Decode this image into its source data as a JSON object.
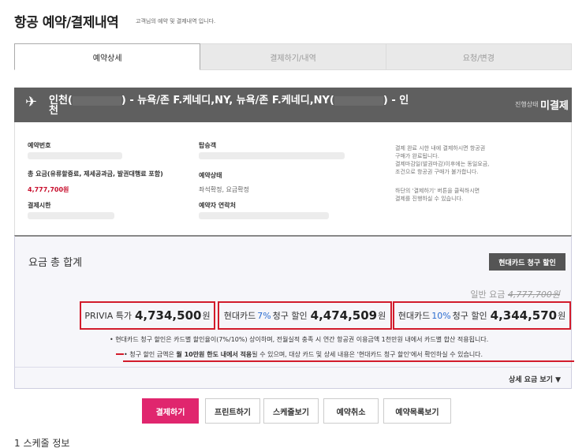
{
  "header": {
    "title": "항공 예약/결제내역",
    "subtitle": "고객님의 예약 및 결제내역 입니다."
  },
  "tabs": [
    {
      "label": "예약상세",
      "active": true
    },
    {
      "label": "결제하기/내역",
      "active": false
    },
    {
      "label": "요청/변경",
      "active": false
    }
  ],
  "flight": {
    "route_a": "인천(",
    "route_b": ") - 뉴욕/존 F.케네디,NY, 뉴욕/존 F.케네디,NY(",
    "route_c": ") - 인",
    "route_d": "천",
    "status_label": "진행상태",
    "status_value": "미결제"
  },
  "info": {
    "booking_no_label": "예약번호",
    "passenger_label": "탑승객",
    "total_label": "총 요금(유류할증료, 제세공과금, 발권대행료 포함)",
    "total_value": "4,777,700원",
    "booking_status_label": "예약상태",
    "booking_status_value": "좌석확정, 요금확정",
    "deadline_label": "결제시한",
    "contact_label": "예약자 연락처",
    "notice_lines": [
      "결제 완료 시한 내에 결제하시면 항공권",
      "구매가 완료됩니다.",
      "결제마감일(발권마감)이후에는 동일요금,",
      "조건으로 항공권 구매가 불가합니다."
    ],
    "notice2_lines": [
      "하단의 '결제하기' 버튼을 클릭하시면",
      "결제를 진행하실 수 있습니다."
    ]
  },
  "summary": {
    "title": "요금 총 합계",
    "hyundai_button": "현대카드 청구 할인",
    "normal_fare_label": "일반 요금",
    "normal_fare_value": "4,777,700원",
    "prices": [
      {
        "prefix": "PRIVIA 특가",
        "rate": "",
        "suffix": "",
        "amount": "4,734,500",
        "unit": "원"
      },
      {
        "prefix": "현대카드",
        "rate": "7%",
        "suffix": "청구 할인",
        "amount": "4,474,509",
        "unit": "원"
      },
      {
        "prefix": "현대카드",
        "rate": "10%",
        "suffix": "청구 할인",
        "amount": "4,344,570",
        "unit": "원"
      }
    ],
    "note1": "• 현대카드 청구 할인은 카드별 할인율이(7%/10%) 상이하며, 전월실적 충족 시 연간 항공권 이용금액 1천만원 내에서 카드별 합산 적용됩니다.",
    "note2_a": "• 청구 할인 금액은 ",
    "note2_b": "월 10만원 한도 내에서 적용",
    "note2_c": "될 수 있으며, 대상 카드 및 상세 내용은 '현대카드 청구 할인'에서 확인하실 수 있습니다.",
    "detail_link": "상세 요금 보기 ▼"
  },
  "actions": {
    "pay": "결제하기",
    "print": "프린트하기",
    "schedule": "스케줄보기",
    "cancel": "예약취소",
    "list": "예약목록보기"
  },
  "schedule_title": "1 스케줄 정보",
  "colors": {
    "accent": "#e0266e",
    "highlight": "#d21b2b",
    "bar": "#5f5f5f",
    "blue": "#2b6cd0"
  }
}
